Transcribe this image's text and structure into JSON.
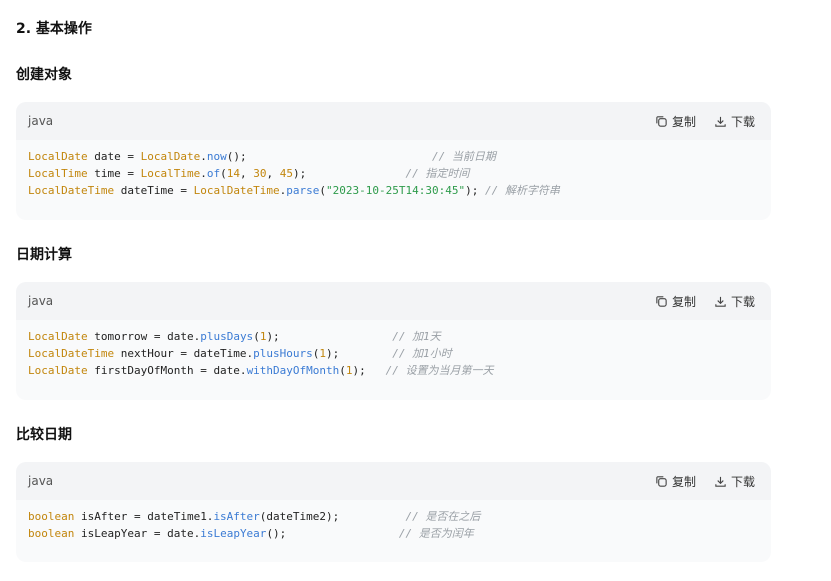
{
  "heading": "2. 基本操作",
  "sections": [
    {
      "title": "创建对象",
      "lang": "java",
      "copy_label": "复制",
      "download_label": "下载",
      "lines": [
        [
          [
            "type",
            "LocalDate"
          ],
          [
            "plain",
            " date = "
          ],
          [
            "type",
            "LocalDate"
          ],
          [
            "plain",
            "."
          ],
          [
            "method",
            "now"
          ],
          [
            "plain",
            "();                            "
          ],
          [
            "comment",
            "// 当前日期"
          ]
        ],
        [
          [
            "type",
            "LocalTime"
          ],
          [
            "plain",
            " time = "
          ],
          [
            "type",
            "LocalTime"
          ],
          [
            "plain",
            "."
          ],
          [
            "method",
            "of"
          ],
          [
            "plain",
            "("
          ],
          [
            "num",
            "14"
          ],
          [
            "plain",
            ", "
          ],
          [
            "num",
            "30"
          ],
          [
            "plain",
            ", "
          ],
          [
            "num",
            "45"
          ],
          [
            "plain",
            ");               "
          ],
          [
            "comment",
            "// 指定时间"
          ]
        ],
        [
          [
            "type",
            "LocalDateTime"
          ],
          [
            "plain",
            " dateTime = "
          ],
          [
            "type",
            "LocalDateTime"
          ],
          [
            "plain",
            "."
          ],
          [
            "method",
            "parse"
          ],
          [
            "plain",
            "("
          ],
          [
            "str",
            "\"2023-10-25T14:30:45\""
          ],
          [
            "plain",
            "); "
          ],
          [
            "comment",
            "// 解析字符串"
          ]
        ]
      ]
    },
    {
      "title": "日期计算",
      "lang": "java",
      "copy_label": "复制",
      "download_label": "下载",
      "lines": [
        [
          [
            "type",
            "LocalDate"
          ],
          [
            "plain",
            " tomorrow = date."
          ],
          [
            "method",
            "plusDays"
          ],
          [
            "plain",
            "("
          ],
          [
            "num",
            "1"
          ],
          [
            "plain",
            ");                 "
          ],
          [
            "comment",
            "// 加1天"
          ]
        ],
        [
          [
            "type",
            "LocalDateTime"
          ],
          [
            "plain",
            " nextHour = dateTime."
          ],
          [
            "method",
            "plusHours"
          ],
          [
            "plain",
            "("
          ],
          [
            "num",
            "1"
          ],
          [
            "plain",
            ");        "
          ],
          [
            "comment",
            "// 加1小时"
          ]
        ],
        [
          [
            "type",
            "LocalDate"
          ],
          [
            "plain",
            " firstDayOfMonth = date."
          ],
          [
            "method",
            "withDayOfMonth"
          ],
          [
            "plain",
            "("
          ],
          [
            "num",
            "1"
          ],
          [
            "plain",
            ");   "
          ],
          [
            "comment",
            "// 设置为当月第一天"
          ]
        ]
      ]
    },
    {
      "title": "比较日期",
      "lang": "java",
      "copy_label": "复制",
      "download_label": "下载",
      "lines": [
        [
          [
            "type",
            "boolean"
          ],
          [
            "plain",
            " isAfter = dateTime1."
          ],
          [
            "method",
            "isAfter"
          ],
          [
            "plain",
            "(dateTime2);          "
          ],
          [
            "comment",
            "// 是否在之后"
          ]
        ],
        [
          [
            "type",
            "boolean"
          ],
          [
            "plain",
            " isLeapYear = date."
          ],
          [
            "method",
            "isLeapYear"
          ],
          [
            "plain",
            "();                 "
          ],
          [
            "comment",
            "// 是否为闰年"
          ]
        ]
      ]
    }
  ],
  "icons": {
    "copy": "copy-icon",
    "download": "download-icon"
  },
  "colors": {
    "type": "#c2860d",
    "method": "#3b7bd4",
    "string": "#2e9b4b",
    "comment": "#9aa0a6",
    "header_bg": "#f3f4f6",
    "block_bg": "#f9fafb"
  }
}
